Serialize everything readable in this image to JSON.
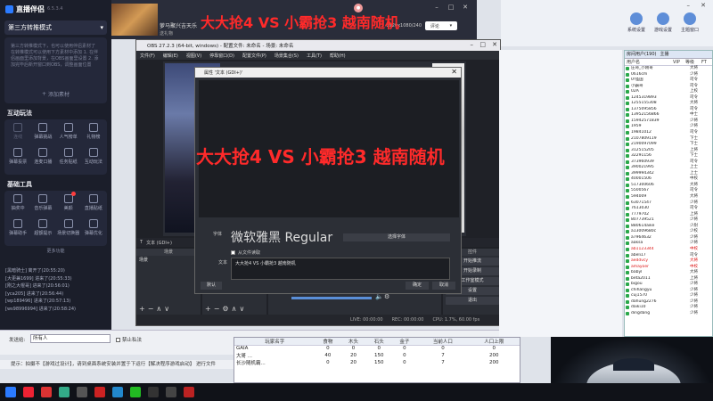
{
  "assistant": {
    "brand_name": "直播伴侣",
    "version": "6.5.3.4",
    "mode": "第三方转推模式",
    "material_note": "第三方转推模式下，也可以使用伴侣素材了 在转推模式可以使用下方素材中添加 1. 在伴侣画面里添加背景，在OBS画面里设置 2. 添加完毕后新开窗口到OBS，调整画面位置",
    "add_material": "添加素材",
    "interact_title": "互动玩法",
    "interact_tools": [
      "连线",
      "弹幕挑战",
      "人气榜单",
      "礼物榜",
      "弹幕投票",
      "连麦口播",
      "任务贴纸",
      "互动玩法"
    ],
    "basic_title": "基础工具",
    "basic_tools": [
      "抽奖中",
      "音乐弹幕",
      "美颜",
      "直播贴纸",
      "弹幕助手",
      "超额提示",
      "场景切换器",
      "弹幕优化"
    ],
    "more": "更多功能",
    "badge_count": "1"
  },
  "topstrip": {
    "room_title": "萝马聚兴吉天乐",
    "room_sub": "送礼物",
    "res": "1920x1080/240",
    "share": "评论"
  },
  "overlay_text": "大大抢4 VS 小霸抢3 越南随机",
  "obs": {
    "title": "OBS 27.2.3 (64-bit, windows) - 配置文件: 未命名 - 场景: 未命名",
    "menu": [
      "文件(F)",
      "编辑(E)",
      "视图(V)",
      "停靠窗口(D)",
      "配置文件(P)",
      "场景集合(S)",
      "工具(T)",
      "帮助(H)"
    ],
    "source_label": "文本 (GDI+)",
    "dock_scenes": "场景",
    "dock_sources": "来源",
    "dock_controls": "控件",
    "scene_item": "场景",
    "controls": [
      "开始推流",
      "开始录制",
      "工作室模式",
      "设置",
      "退出"
    ],
    "status": [
      "LIVE: 00:00:00",
      "REC: 00:00:00",
      "CPU: 1.7%, 60.00 fps"
    ]
  },
  "props": {
    "title": "属性 '文本 (GDI+)'",
    "font_label": "字体",
    "font_name": "微软雅黑 Regular",
    "pick_font": "选择字体",
    "from_file": "从文件读取",
    "text_label": "文本",
    "text_value": "大大抢4 VS 小霸抢3 越南随机",
    "defaults": "默认",
    "ok": "确定",
    "cancel": "取消"
  },
  "control_tabs": [
    "系统设置",
    "游戏设置",
    "主题窗口"
  ],
  "userlist": {
    "tabs": [
      "房间用户(190)",
      "主播"
    ],
    "headers": [
      "用户名",
      "VIP",
      "等级",
      "FT"
    ],
    "rows": [
      [
        "庄哥_小刚哥",
        "大将"
      ],
      [
        "0616cm",
        "少将"
      ],
      [
        "0!怪国",
        "司令"
      ],
      [
        "小霸哥",
        "司令"
      ],
      [
        "02A",
        "上校"
      ],
      [
        "1245319893",
        "司令"
      ],
      [
        "1255155308",
        "大将"
      ],
      [
        "1375095856",
        "司令"
      ],
      [
        "13952156866",
        "中士"
      ],
      [
        "15942571839",
        "少将"
      ],
      [
        "1959",
        "少将"
      ],
      [
        "19841012",
        "司令"
      ],
      [
        "2107809119",
        "下士"
      ],
      [
        "2190097099",
        "下士"
      ],
      [
        "312515205",
        "上将"
      ],
      [
        "32291156",
        "下士"
      ],
      [
        "373960939",
        "司令"
      ],
      [
        "390021995",
        "上士"
      ],
      [
        "399994342",
        "上士"
      ],
      [
        "40001506",
        "中校"
      ],
      [
        "517300606",
        "大将"
      ],
      [
        "5500567",
        "司令"
      ],
      [
        "594009",
        "大将"
      ],
      [
        "63071547",
        "少将"
      ],
      [
        "7613030",
        "司令"
      ],
      [
        "7779702",
        "上将"
      ],
      [
        "807739521",
        "少将"
      ],
      [
        "880614aike",
        "少尉"
      ],
      [
        "a13009680c",
        "少校"
      ],
      [
        "a7964632",
        "少将"
      ],
      [
        "aaksa",
        "少将"
      ],
      [
        "ab1123344",
        "中校"
      ],
      [
        "abeli17",
        "司令"
      ],
      [
        "aeddvcy",
        "大将"
      ],
      [
        "amayoer",
        "中校"
      ],
      [
        "babyl",
        "大将"
      ],
      [
        "beta2011",
        "上将"
      ],
      [
        "bigou",
        "少将"
      ],
      [
        "chihangyu",
        "少将"
      ],
      [
        "cuj1570",
        "少将"
      ],
      [
        "dahung2276",
        "少将"
      ],
      [
        "daiki10",
        "少将"
      ],
      [
        "dingdang",
        "少将"
      ]
    ]
  },
  "chat": [
    "[黑暗骑士] 离开了(20:55:20)",
    "[大更兼1699] 进来了(20:55:33)",
    "[刚之大棍哥] 进来了(20:56:01)",
    "[yca205] 进来了(20:56:44)",
    "[wp189496] 进来了(20:57:13)",
    "[ws98996994] 进来了(20:58:24)"
  ],
  "chatbar": {
    "sendto_label": "发送给:",
    "sendto_value": "所有人",
    "mute_label": "禁止私法"
  },
  "hint": "提示：拍摄不【游戏过设计】，请到桌面系统安装并置于下运行【解决程序游戏启动】 进行文件",
  "gametable": {
    "headers": [
      "玩家名字",
      "食物",
      "木头",
      "石头",
      "金子",
      "当前人口",
      "人口上限"
    ],
    "rows": [
      [
        "GAIA",
        "0",
        "0",
        "0",
        "0",
        "0",
        "0"
      ],
      [
        "大哥 ...",
        "40",
        "20",
        "150",
        "0",
        "7",
        "200"
      ],
      [
        "长沙随机霸...",
        "0",
        "20",
        "150",
        "0",
        "7",
        "200"
      ]
    ]
  },
  "colors": {
    "overlay_red": "#ff2a2a",
    "assistant_bg": "#1b1e2a",
    "obs_bg": "#1f2127"
  }
}
